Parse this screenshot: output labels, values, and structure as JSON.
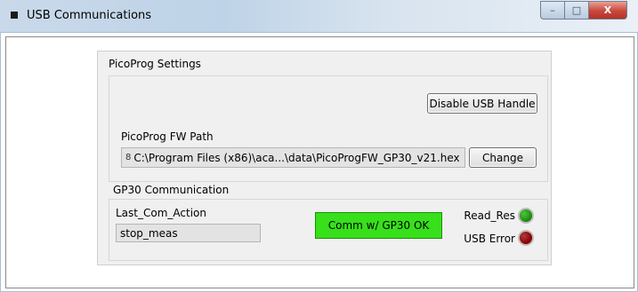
{
  "window": {
    "title": "USB Communications",
    "min_glyph": "–",
    "max_glyph": "□",
    "close_glyph": "X"
  },
  "picoprog": {
    "section_title": "PicoProg Settings",
    "disable_usb_label": "Disable USB Handle",
    "fw_path_label": "PicoProg FW Path",
    "fw_path_icon": "8",
    "fw_path_value": "C:\\Program Files (x86)\\aca...\\data\\PicoProgFW_GP30_v21.hex",
    "change_label": "Change"
  },
  "gp30": {
    "section_title": "GP30 Communication",
    "last_action_label": "Last_Com_Action",
    "last_action_value": "stop_meas",
    "status_label": "Comm w/ GP30 OK",
    "read_res_label": "Read_Res",
    "usb_error_label": "USB Error"
  },
  "colors": {
    "status_ok": "#37e01a",
    "led_read_res": "#1f8a12",
    "led_usb_error": "#8b0000"
  }
}
